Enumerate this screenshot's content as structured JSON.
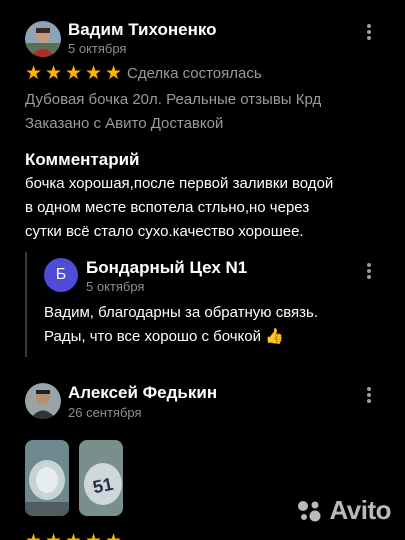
{
  "review1": {
    "author": "Вадим Тихоненко",
    "date": "5 октября",
    "rating": 5,
    "stars": [
      "★",
      "★",
      "★",
      "★",
      "★"
    ],
    "deal_status": "Сделка состоялась",
    "item": "Дубовая бочка 20л. Реальные отзывы Крд",
    "delivery": "Заказано с Авито Доставкой",
    "comment_heading": "Комментарий",
    "comment_lines": [
      "бочка хорошая,после первой заливки водой",
      "в одном месте вспотела стльно,но через",
      "сутки всё стало сухо.качество хорошее."
    ],
    "reply": {
      "avatar_letter": "Б",
      "author": "Бондарный Цех N1",
      "date": "5 октября",
      "lines": [
        "Вадим, благодарны за обратную связь.",
        "Рады, что все хорошо с бочкой"
      ],
      "emoji": "👍"
    }
  },
  "review2": {
    "author": "Алексей Федькин",
    "date": "26 сентября",
    "photos": [
      "photo-1",
      "photo-2"
    ]
  },
  "watermark": "Avito",
  "colors": {
    "star": "#ffb400",
    "reply_avatar": "#4f4dd8",
    "muted": "#9a9a9a",
    "background": "#000000"
  }
}
